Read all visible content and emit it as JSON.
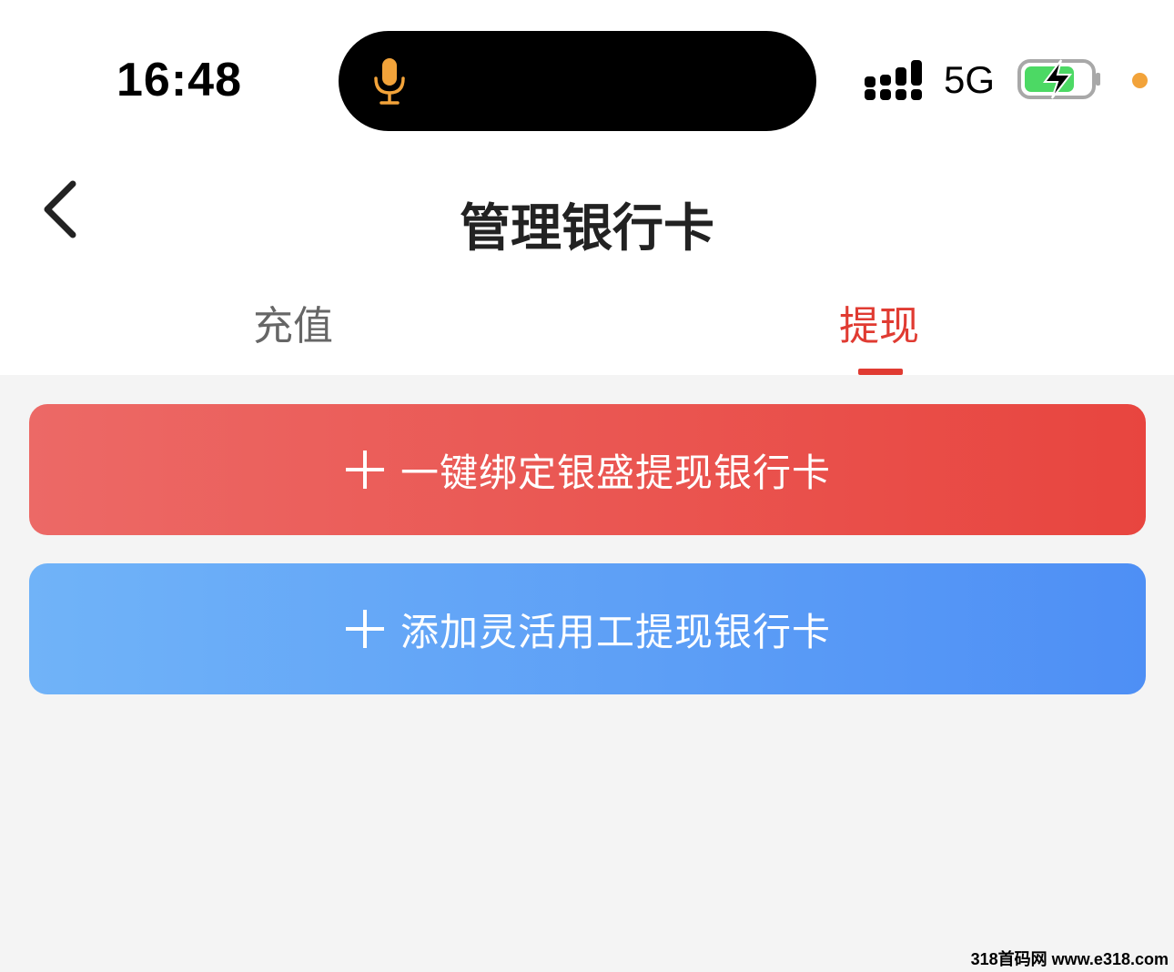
{
  "status_bar": {
    "time": "16:48",
    "network": "5G",
    "icons": [
      "microphone-icon",
      "signal-icon",
      "battery-charging-icon",
      "privacy-dot"
    ],
    "colors": {
      "mic": "#f2a33a",
      "battery_fill": "#4cd964",
      "dot": "#f2a33a"
    }
  },
  "nav": {
    "title": "管理银行卡",
    "back_icon": "chevron-left-icon"
  },
  "tabs": [
    {
      "label": "充值",
      "active": false
    },
    {
      "label": "提现",
      "active": true
    }
  ],
  "actions": [
    {
      "icon": "plus-icon",
      "label": "一键绑定银盛提现银行卡",
      "color": "#e8453f"
    },
    {
      "icon": "plus-icon",
      "label": "添加灵活用工提现银行卡",
      "color": "#4e8ff5"
    }
  ],
  "watermark": "318首码网 www.e318.com",
  "colors": {
    "accent": "#e03b32",
    "background": "#f4f4f4"
  }
}
